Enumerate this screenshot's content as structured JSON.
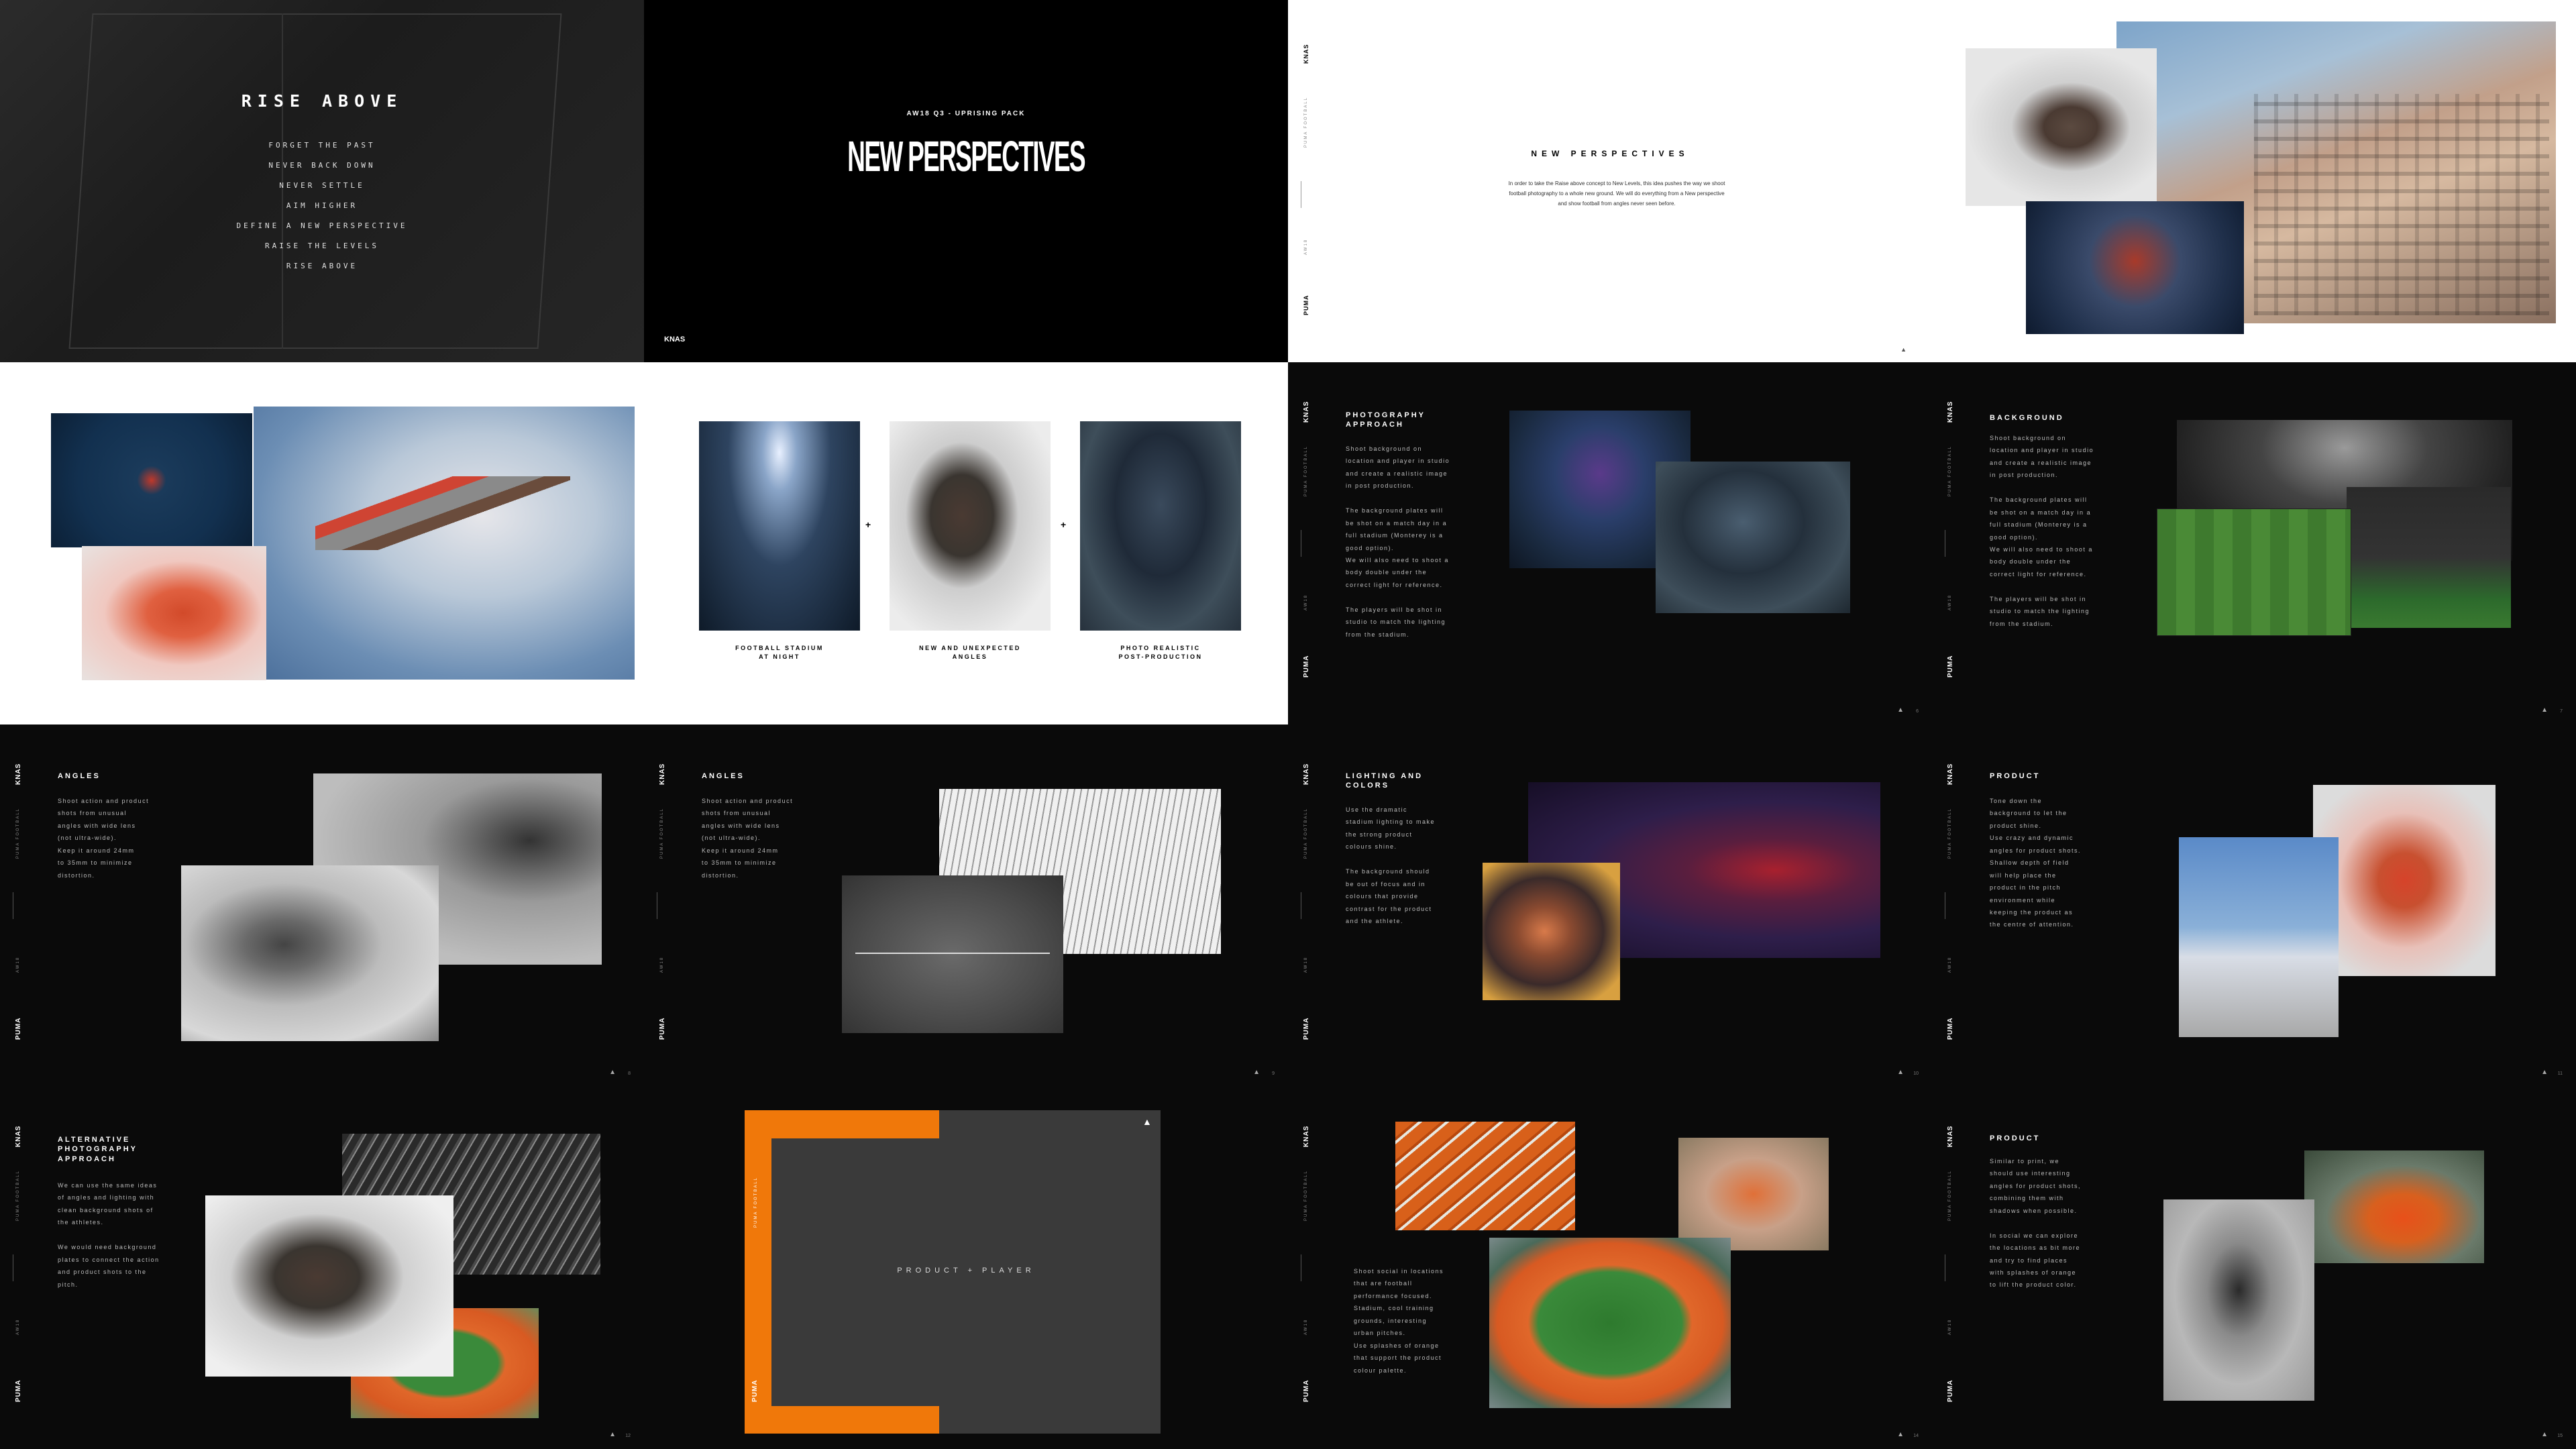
{
  "brand": "KNAS",
  "side_label": "PUMA FOOTBALL",
  "side_sub": "AW18",
  "footer_brand": "PUMA",
  "slide1": {
    "title": "RISE ABOVE",
    "lines": [
      "FORGET THE PAST",
      "NEVER BACK DOWN",
      "NEVER SETTLE",
      "AIM HIGHER",
      "DEFINE A NEW PERSPECTIVE",
      "RAISE THE LEVELS",
      "RISE ABOVE"
    ]
  },
  "slide2": {
    "kicker": "AW18 Q3 - UPRISING PACK",
    "title": "NEW PERSPECTIVES",
    "brand": "KNAS"
  },
  "slide3": {
    "title": "NEW PERSPECTIVES",
    "body": "In order to take the Raise above concept to New Levels, this idea pushes the way we shoot football photography to a whole new ground. We will do everything from a New perspective and show football from angles never seen before."
  },
  "slide6": {
    "plus": "+",
    "captions": [
      "FOOTBALL STADIUM\nAT NIGHT",
      "NEW AND UNEXPECTED\nANGLES",
      "PHOTO REALISTIC\nPOST-PRODUCTION"
    ]
  },
  "slide7": {
    "title": "PHOTOGRAPHY\nAPPROACH",
    "body": "Shoot background on\nlocation and player in studio\nand create a realistic image\nin post production.\n\nThe background plates will\nbe shot on a match day in a\nfull stadium (Monterey is a\ngood option).\nWe will also need to shoot a\nbody double under the\ncorrect light for reference.\n\nThe players will be shot in\nstudio to match the lighting\nfrom the stadium."
  },
  "slide8": {
    "title": "BACKGROUND",
    "body": "Shoot background on\nlocation and player in studio\nand create a realistic image\nin post production.\n\nThe background plates will\nbe shot on a match day in a\nfull stadium (Monterey is a\ngood option).\nWe will also need to shoot a\nbody double under the\ncorrect light for reference.\n\nThe players will be shot in\nstudio to match the lighting\nfrom the stadium."
  },
  "slide9": {
    "title": "ANGLES",
    "body": "Shoot action and product\nshots from unusual\nangles with wide lens\n(not ultra-wide).\nKeep it around 24mm\nto 35mm to minimize\ndistortion."
  },
  "slide10": {
    "title": "ANGLES",
    "body": "Shoot action and product\nshots from unusual\nangles with wide lens\n(not ultra-wide).\nKeep it around 24mm\nto 35mm to minimize\ndistortion."
  },
  "slide11": {
    "title": "LIGHTING AND\nCOLORS",
    "body": "Use the dramatic\nstadium lighting to make\nthe strong product\ncolours shine.\n\nThe background should\nbe out of focus and in\ncolours that provide\ncontrast for the product\nand the athlete."
  },
  "slide12": {
    "title": "PRODUCT",
    "body": "Tone down the\nbackground to let the\nproduct shine.\nUse crazy and dynamic\nangles for product shots.\nShallow depth of field\nwill help place the\nproduct in the pitch\nenvironment while\nkeeping the product as\nthe centre of attention."
  },
  "slide13": {
    "title": "ALTERNATIVE\nPHOTOGRAPHY\nAPPROACH",
    "body": "We can use the same ideas\nof angles and lighting with\nclean background shots of\nthe athletes.\n\nWe would need background\nplates to connect the action\nand product shots to the\npitch."
  },
  "slide14": {
    "label": "PRODUCT + PLAYER"
  },
  "slide15": {
    "body": "Shoot social in locations\nthat are football\nperformance focused.\nStadium, cool training\ngrounds, interesting\nurban pitches.\nUse splashes of orange\nthat support the product\ncolour palette."
  },
  "slide16": {
    "title": "PRODUCT",
    "body": "Similar to print, we\nshould use interesting\nangles for product shots,\ncombining them with\nshadows when possible.\n\nIn social we can explore\nthe locations as bit more\nand try to find places\nwith splashes of orange\nto lift the product color."
  },
  "colors": {
    "accent_orange": "#f0780a",
    "dark": "#0a0a0a",
    "panel_grey": "#3a3a3a"
  }
}
